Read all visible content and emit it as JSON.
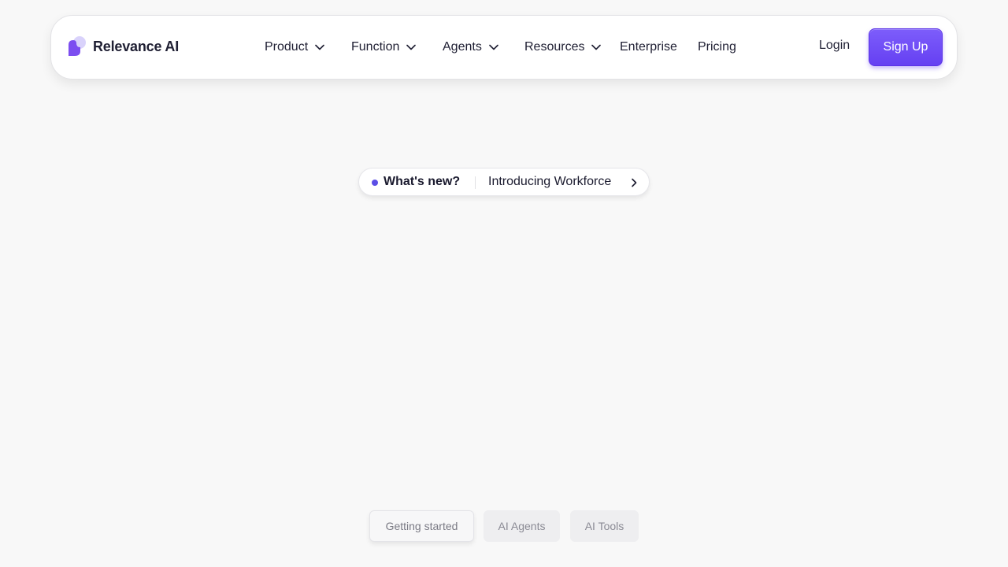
{
  "brand": {
    "name": "Relevance AI",
    "accent": "#6540f2"
  },
  "nav": {
    "items": [
      {
        "label": "Product",
        "has_dropdown": true
      },
      {
        "label": "Function",
        "has_dropdown": true
      },
      {
        "label": "Agents",
        "has_dropdown": true
      },
      {
        "label": "Resources",
        "has_dropdown": true
      },
      {
        "label": "Enterprise",
        "has_dropdown": false
      },
      {
        "label": "Pricing",
        "has_dropdown": false
      }
    ],
    "login_label": "Login",
    "signup_label": "Sign Up"
  },
  "announcement": {
    "badge_label": "What's new?",
    "link_label": "Introducing Workforce",
    "icon": "chevron-right-icon"
  },
  "tabs": {
    "items": [
      {
        "label": "Getting started",
        "active": true
      },
      {
        "label": "AI Agents",
        "active": false
      },
      {
        "label": "AI Tools",
        "active": false
      }
    ]
  }
}
